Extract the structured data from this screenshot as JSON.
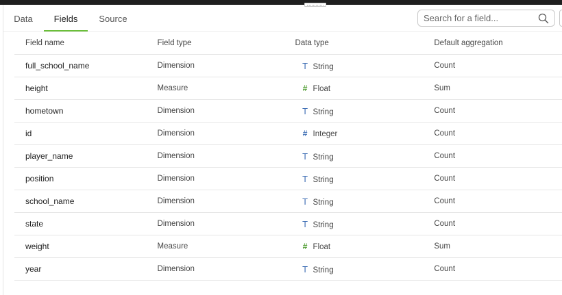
{
  "tabs": [
    {
      "label": "Data",
      "active": false
    },
    {
      "label": "Fields",
      "active": true
    },
    {
      "label": "Source",
      "active": false
    }
  ],
  "search": {
    "placeholder": "Search for a field..."
  },
  "table": {
    "headers": [
      "Field name",
      "Field type",
      "Data type",
      "Default aggregation"
    ],
    "rows": [
      {
        "name": "full_school_name",
        "field_type": "Dimension",
        "data_type": "String",
        "icon": "text-type-icon",
        "aggregation": "Count"
      },
      {
        "name": "height",
        "field_type": "Measure",
        "data_type": "Float",
        "icon": "hash-icon",
        "aggregation": "Sum"
      },
      {
        "name": "hometown",
        "field_type": "Dimension",
        "data_type": "String",
        "icon": "text-type-icon",
        "aggregation": "Count"
      },
      {
        "name": "id",
        "field_type": "Dimension",
        "data_type": "Integer",
        "icon": "hash-icon",
        "aggregation": "Count"
      },
      {
        "name": "player_name",
        "field_type": "Dimension",
        "data_type": "String",
        "icon": "text-type-icon",
        "aggregation": "Count"
      },
      {
        "name": "position",
        "field_type": "Dimension",
        "data_type": "String",
        "icon": "text-type-icon",
        "aggregation": "Count"
      },
      {
        "name": "school_name",
        "field_type": "Dimension",
        "data_type": "String",
        "icon": "text-type-icon",
        "aggregation": "Count"
      },
      {
        "name": "state",
        "field_type": "Dimension",
        "data_type": "String",
        "icon": "text-type-icon",
        "aggregation": "Count"
      },
      {
        "name": "weight",
        "field_type": "Measure",
        "data_type": "Float",
        "icon": "hash-icon",
        "aggregation": "Sum"
      },
      {
        "name": "year",
        "field_type": "Dimension",
        "data_type": "String",
        "icon": "text-type-icon",
        "aggregation": "Count"
      }
    ]
  },
  "colors": {
    "accent": "#6bbf3a",
    "dimension_icon": "#3f6fb5",
    "measure_icon": "#4a9a2c"
  }
}
